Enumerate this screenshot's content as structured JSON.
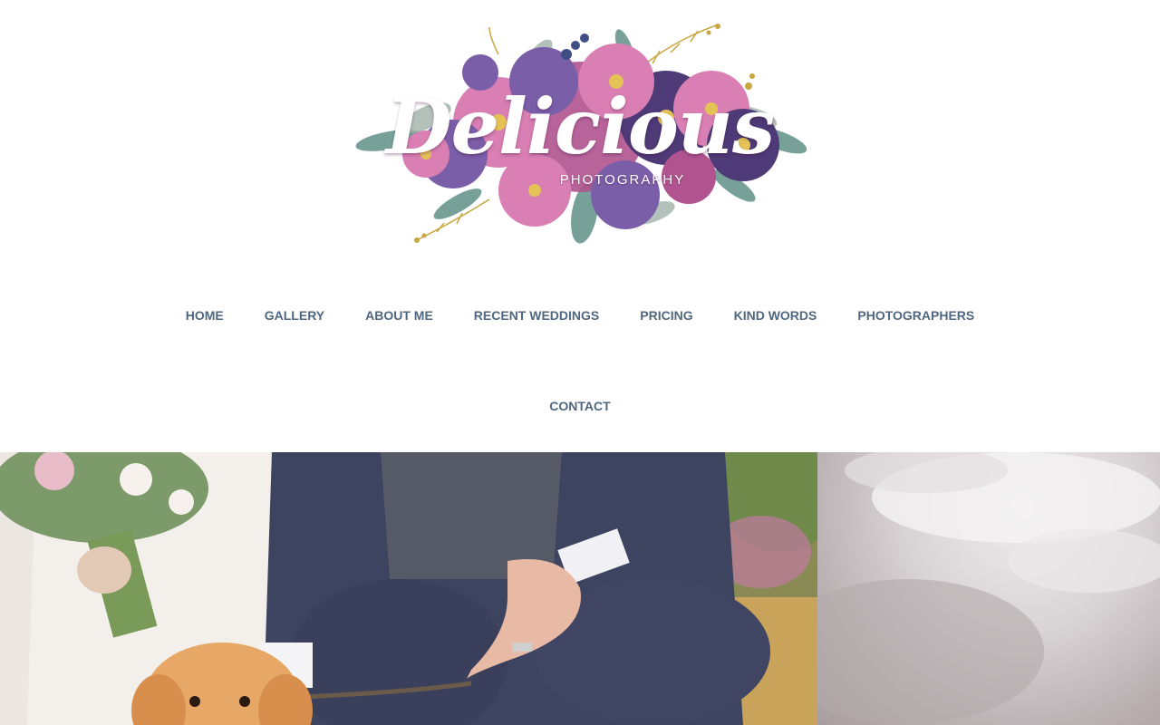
{
  "brand": {
    "logo_word": "Delicious",
    "logo_sub": "PHOTOGRAPHY",
    "palette": {
      "pink": "#d97fb3",
      "deep_purple": "#4e3a77",
      "violet": "#7b5ea8",
      "teal_leaf": "#5e8f86",
      "gold": "#c9a640"
    }
  },
  "nav": {
    "row1": [
      {
        "label": "HOME"
      },
      {
        "label": "GALLERY"
      },
      {
        "label": "ABOUT ME"
      },
      {
        "label": "RECENT WEDDINGS"
      },
      {
        "label": "PRICING"
      },
      {
        "label": "KIND WORDS"
      },
      {
        "label": "PHOTOGRAPHERS"
      }
    ],
    "row2": [
      {
        "label": "CONTACT"
      }
    ],
    "link_color": "#4f6780"
  },
  "hero": {
    "slides": [
      {
        "name": "wedding-couple-with-dog-photo"
      },
      {
        "name": "cloudy-sky-photo"
      }
    ]
  }
}
